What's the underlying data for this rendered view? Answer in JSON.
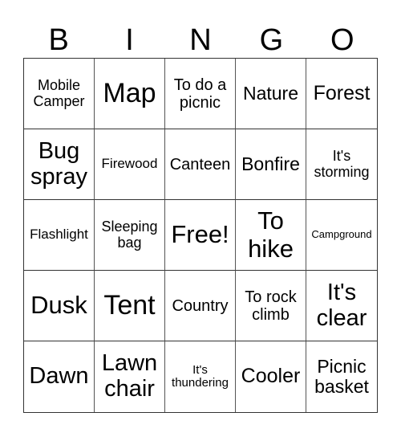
{
  "header": {
    "letters": [
      "B",
      "I",
      "N",
      "G",
      "O"
    ]
  },
  "board": {
    "cells": [
      "Mobile Camper",
      "Map",
      "To do a picnic",
      "Nature",
      "Forest",
      "Bug spray",
      "Firewood",
      "Canteen",
      "Bonfire",
      "It's storming",
      "Flashlight",
      "Sleeping bag",
      "Free!",
      "To hike",
      "Campground",
      "Dusk",
      "Tent",
      "Country",
      "To rock climb",
      "It's clear",
      "Dawn",
      "Lawn chair",
      "It's thundering",
      "Cooler",
      "Picnic basket"
    ]
  }
}
